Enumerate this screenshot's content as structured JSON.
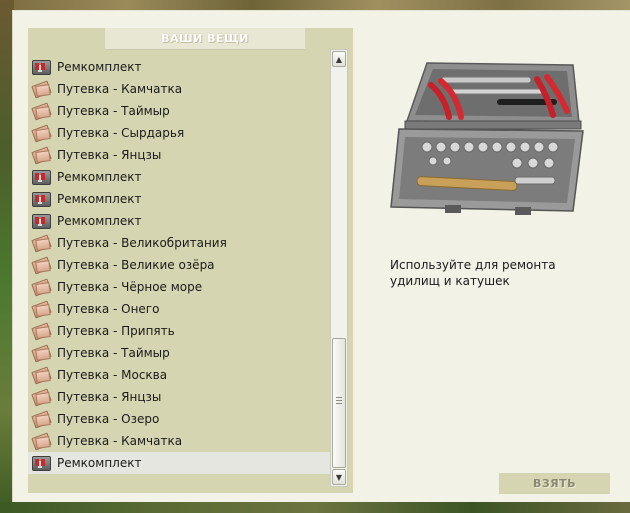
{
  "panel": {
    "title": "ВАШИ ВЕЩИ"
  },
  "items": [
    {
      "label": "Ремкомплект",
      "icon": "repair-kit-icon"
    },
    {
      "label": "Путевка - Камчатка",
      "icon": "ticket-icon"
    },
    {
      "label": "Путевка - Таймыр",
      "icon": "ticket-icon"
    },
    {
      "label": "Путевка - Сырдарья",
      "icon": "ticket-icon"
    },
    {
      "label": "Путевка - Янцзы",
      "icon": "ticket-icon"
    },
    {
      "label": "Ремкомплект",
      "icon": "repair-kit-icon"
    },
    {
      "label": "Ремкомплект",
      "icon": "repair-kit-icon"
    },
    {
      "label": "Ремкомплект",
      "icon": "repair-kit-icon"
    },
    {
      "label": "Путевка - Великобритания",
      "icon": "ticket-icon"
    },
    {
      "label": "Путевка - Великие озёра",
      "icon": "ticket-icon"
    },
    {
      "label": "Путевка - Чёрное море",
      "icon": "ticket-icon"
    },
    {
      "label": "Путевка - Онего",
      "icon": "ticket-icon"
    },
    {
      "label": "Путевка - Припять",
      "icon": "ticket-icon"
    },
    {
      "label": "Путевка - Таймыр",
      "icon": "ticket-icon"
    },
    {
      "label": "Путевка - Москва",
      "icon": "ticket-icon"
    },
    {
      "label": "Путевка - Янцзы",
      "icon": "ticket-icon"
    },
    {
      "label": "Путевка - Озеро",
      "icon": "ticket-icon"
    },
    {
      "label": "Путевка - Камчатка",
      "icon": "ticket-icon"
    },
    {
      "label": "Ремкомплект",
      "icon": "repair-kit-icon"
    }
  ],
  "selected_index": 18,
  "detail": {
    "image": "toolbox-icon",
    "description": "Используйте для ремонта удилищ и катушек"
  },
  "actions": {
    "take_label": "ВЗЯТЬ"
  },
  "colors": {
    "panel_bg": "#d6d5b2",
    "dialog_bg": "#f3f2e6",
    "selected_row": "#e6e6e0",
    "button_text": "#8a8870"
  }
}
